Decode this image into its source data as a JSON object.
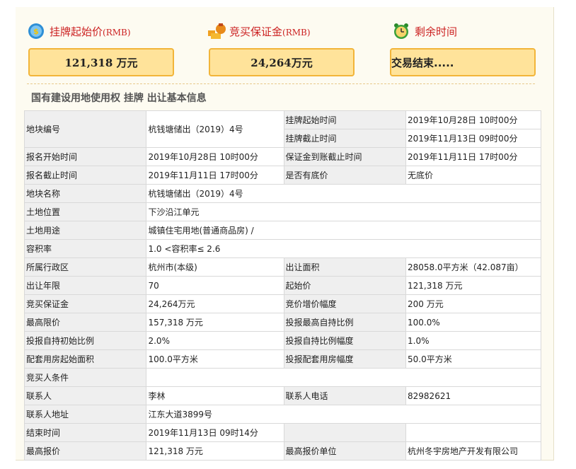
{
  "headers": {
    "start_price_label": "挂牌起始价",
    "start_price_unit": "(RMB)",
    "deposit_label": "竞买保证金",
    "deposit_unit": "(RMB)",
    "time_label": "剩余时间"
  },
  "boxes": {
    "start_price": "121,318 万元",
    "deposit": "24,264万元",
    "time": "交易结束....."
  },
  "section_title": "国有建设用地使用权 挂牌 出让基本信息",
  "rows": [
    [
      "地块编号",
      "杭钱塘储出（2019）4号",
      "挂牌起始时间",
      "2019年10月28日 10时00分"
    ],
    [
      "",
      "",
      "挂牌截止时间",
      "2019年11月13日 09时00分"
    ],
    [
      "报名开始时间",
      "2019年10月28日 10时00分",
      "保证金到账截止时间",
      "2019年11月11日 17时00分"
    ],
    [
      "报名截止时间",
      "2019年11月11日 17时00分",
      "是否有底价",
      "无底价"
    ],
    [
      "地块名称",
      "杭钱塘储出（2019）4号"
    ],
    [
      "土地位置",
      "下沙沿江单元"
    ],
    [
      "土地用途",
      "城镇住宅用地(普通商品房) /"
    ],
    [
      "容积率",
      "1.0 <容积率≤ 2.6"
    ],
    [
      "所属行政区",
      "杭州市(本级)",
      "出让面积",
      "28058.0平方米（42.087亩）"
    ],
    [
      "出让年限",
      "70",
      "起始价",
      "121,318 万元"
    ],
    [
      "竞买保证金",
      "24,264万元",
      "竞价增价幅度",
      "200 万元"
    ],
    [
      "最高限价",
      "157,318 万元",
      "投报最高自持比例",
      "100.0%"
    ],
    [
      "投报自持初始比例",
      "2.0%",
      "投报自持比例幅度",
      "1.0%"
    ],
    [
      "配套用房起始面积",
      "100.0平方米",
      "投报配套用房幅度",
      "50.0平方米"
    ],
    [
      "竞买人条件",
      ""
    ],
    [
      "联系人",
      "李林",
      "联系人电话",
      "82982621"
    ],
    [
      "联系人地址",
      "江东大道3899号"
    ],
    [
      "结束时间",
      "2019年11月13日 09时14分",
      "",
      ""
    ],
    [
      "最高报价",
      "121,318 万元",
      "最高报价单位",
      "杭州冬宇房地产开发有限公司"
    ]
  ],
  "icons": {
    "price": "coin-price-icon",
    "deposit": "money-bag-icon",
    "time": "alarm-clock-icon"
  }
}
